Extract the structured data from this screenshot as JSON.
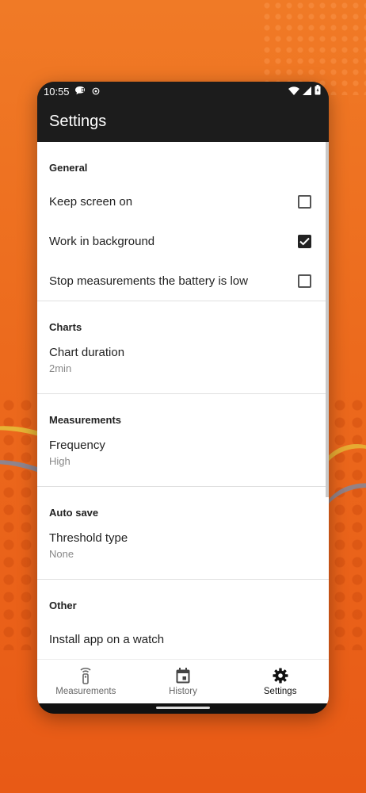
{
  "status_bar": {
    "time": "10:55"
  },
  "app_bar": {
    "title": "Settings"
  },
  "sections": {
    "general": {
      "header": "General",
      "keep_screen_on": {
        "label": "Keep screen on",
        "checked": false
      },
      "work_in_background": {
        "label": "Work in background",
        "checked": true
      },
      "stop_measurements": {
        "label": "Stop measurements the battery is low",
        "checked": false
      }
    },
    "charts": {
      "header": "Charts",
      "chart_duration": {
        "title": "Chart duration",
        "summary": "2min"
      }
    },
    "measurements": {
      "header": "Measurements",
      "frequency": {
        "title": "Frequency",
        "summary": "High"
      }
    },
    "auto_save": {
      "header": "Auto save",
      "threshold_type": {
        "title": "Threshold type",
        "summary": "None"
      }
    },
    "other": {
      "header": "Other",
      "install_app": {
        "label": "Install app on a watch"
      }
    }
  },
  "bottom_nav": {
    "items": [
      {
        "label": "Measurements",
        "icon": "antenna-icon",
        "active": false
      },
      {
        "label": "History",
        "icon": "calendar-icon",
        "active": false
      },
      {
        "label": "Settings",
        "icon": "gear-icon",
        "active": true
      }
    ]
  },
  "colors": {
    "background_orange": "#ec6a1d",
    "app_bar": "#1c1c1c"
  }
}
